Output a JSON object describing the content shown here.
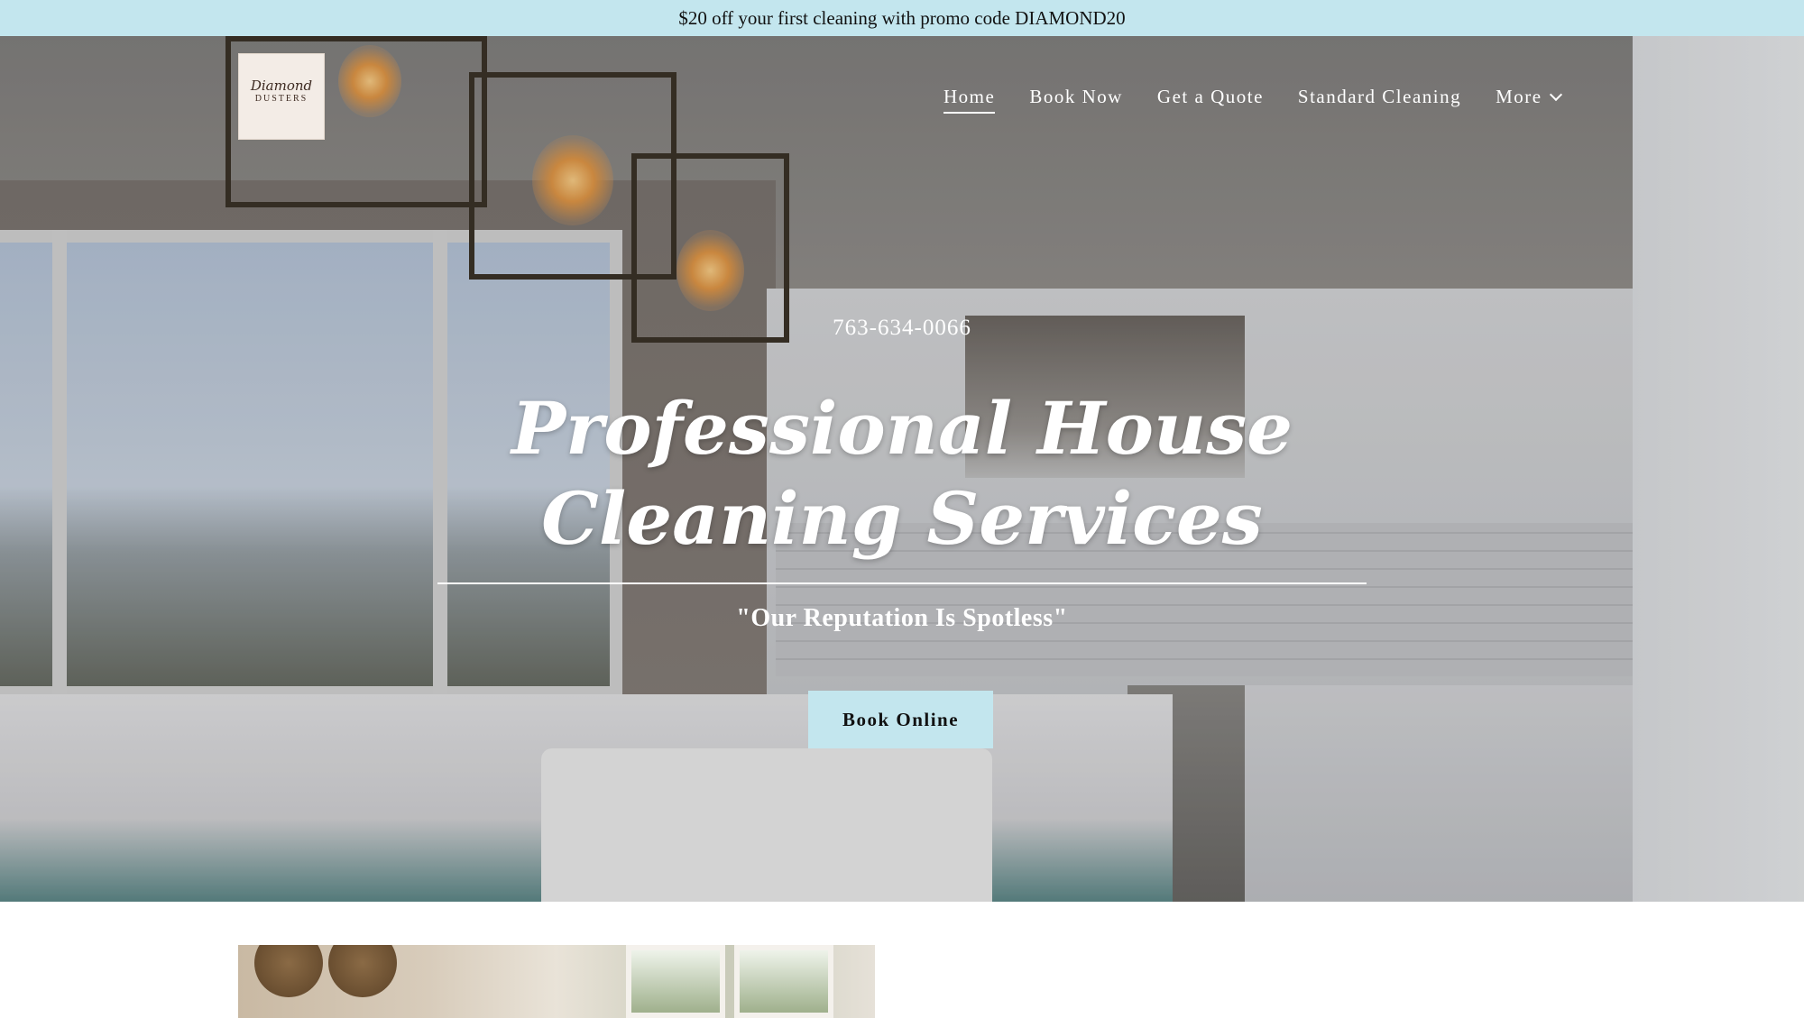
{
  "promo": {
    "text": "$20 off your first cleaning with promo code DIAMOND20"
  },
  "logo": {
    "line1": "Diamond",
    "line2": "DUSTERS"
  },
  "nav": {
    "items": [
      {
        "label": "Home",
        "active": true
      },
      {
        "label": "Book Now"
      },
      {
        "label": "Get a Quote"
      },
      {
        "label": "Standard Cleaning"
      },
      {
        "label": "More"
      }
    ],
    "more_icon": "chevron-down-icon"
  },
  "hero": {
    "phone": "763-634-0066",
    "headline": "Professional House Cleaning Services",
    "tagline": "\"Our Reputation Is Spotless\"",
    "cta_label": "Book Online"
  },
  "colors": {
    "promo_bg": "#c3e6ee",
    "cta_bg": "#c3e6ee",
    "hero_text": "#ffffff"
  }
}
